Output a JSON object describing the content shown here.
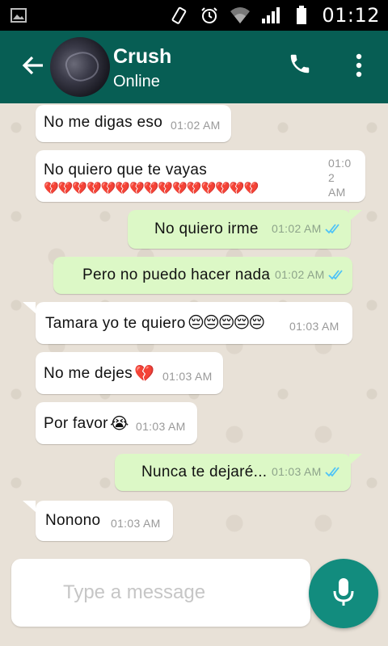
{
  "status_bar": {
    "time": "01:12"
  },
  "header": {
    "contact_name": "Crush",
    "contact_status": "Online"
  },
  "messages": [
    {
      "direction": "in",
      "text": "No me digas eso",
      "time": "01:02 AM"
    },
    {
      "direction": "in",
      "text": "No quiero que te vayas",
      "emoji": "💔💔💔💔💔💔💔💔💔💔💔💔💔💔💔",
      "time_lines": [
        "01:0",
        "2",
        "AM"
      ]
    },
    {
      "direction": "out",
      "text": "No quiero irme",
      "time": "01:02 AM",
      "read": true
    },
    {
      "direction": "out",
      "text": "Pero no puedo hacer nada",
      "time": "01:02 AM",
      "read": true
    },
    {
      "direction": "in",
      "text": "Tamara yo te quiero",
      "emoji": "😔😔😔😔😔",
      "time": "01:03 AM"
    },
    {
      "direction": "in",
      "text": "No me dejes",
      "emoji": "💔",
      "time": "01:03 AM"
    },
    {
      "direction": "in",
      "text": "Por favor",
      "emoji": "😭",
      "time": "01:03 AM"
    },
    {
      "direction": "out",
      "text": "Nunca te dejaré...",
      "time": "01:03 AM",
      "read": true
    },
    {
      "direction": "in",
      "text": "Nonono",
      "time": "01:03 AM"
    }
  ],
  "composer": {
    "placeholder": "Type a message"
  },
  "colors": {
    "header": "#075e54",
    "outgoing_bubble": "#dcf8c6",
    "incoming_bubble": "#ffffff",
    "read_ticks": "#4fc3f7",
    "mic_button": "#128c7e"
  },
  "icons": [
    "image-icon",
    "vibrate-icon",
    "alarm-icon",
    "wifi-icon",
    "signal-icon",
    "battery-icon",
    "back-arrow-icon",
    "phone-icon",
    "more-vert-icon",
    "mic-icon",
    "double-check-icon"
  ]
}
